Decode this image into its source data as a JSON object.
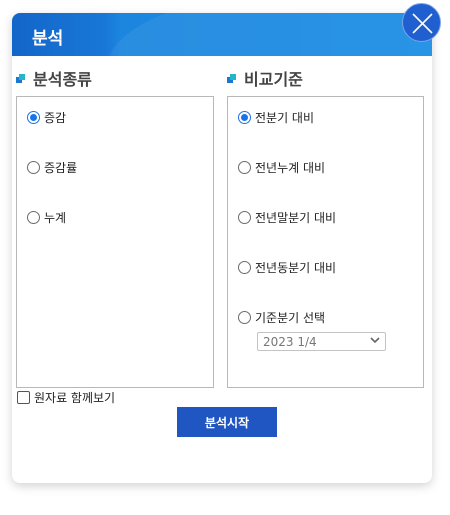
{
  "dialog": {
    "title": "분석",
    "close_icon": "close-icon"
  },
  "analysis_type": {
    "heading": "분석종류",
    "options": [
      {
        "label": "증감",
        "selected": true
      },
      {
        "label": "증감률",
        "selected": false
      },
      {
        "label": "누계",
        "selected": false
      }
    ]
  },
  "comparison": {
    "heading": "비교기준",
    "options": [
      {
        "label": "전분기 대비",
        "selected": true
      },
      {
        "label": "전년누계 대비",
        "selected": false
      },
      {
        "label": "전년말분기 대비",
        "selected": false
      },
      {
        "label": "전년동분기 대비",
        "selected": false
      },
      {
        "label": "기준분기 선택",
        "selected": false
      }
    ],
    "quarter_select": {
      "value": "2023 1/4"
    }
  },
  "raw_data_checkbox": {
    "label": "원자료 함께보기",
    "checked": false
  },
  "start_button": {
    "label": "분석시작"
  },
  "colors": {
    "accent": "#1f56c2",
    "title_bar": "#1b8ee4",
    "radio_selected": "#1a73e8"
  }
}
